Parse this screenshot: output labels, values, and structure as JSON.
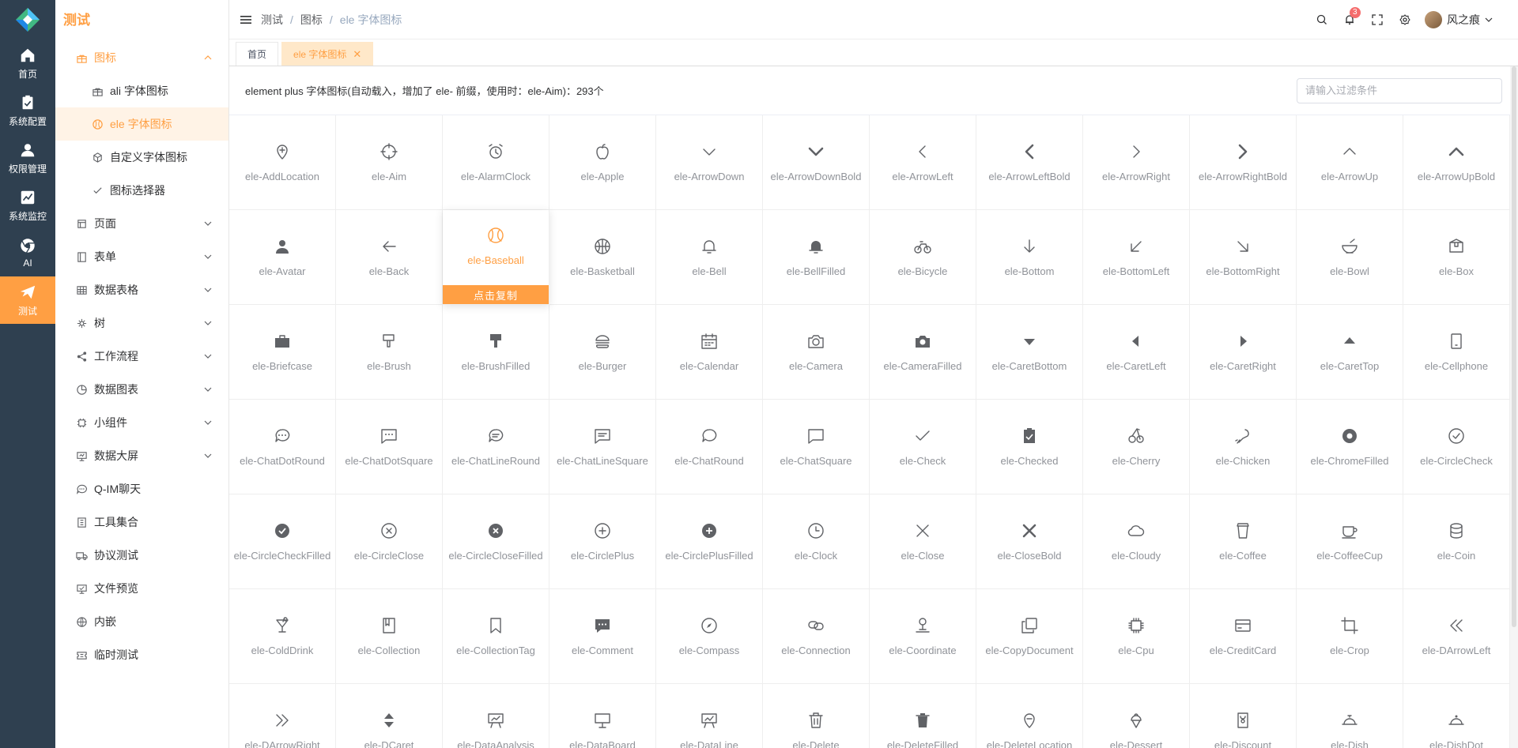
{
  "rail": {
    "items": [
      {
        "label": "首页",
        "icon": "home-icon"
      },
      {
        "label": "系统配置",
        "icon": "clipboard-icon"
      },
      {
        "label": "权限管理",
        "icon": "user-icon"
      },
      {
        "label": "系统监控",
        "icon": "chart-line-icon"
      },
      {
        "label": "AI",
        "icon": "chrome-icon"
      },
      {
        "label": "测试",
        "icon": "paper-plane-icon",
        "active": true
      }
    ]
  },
  "submenu": {
    "title": "测试",
    "items": [
      {
        "label": "图标",
        "icon": "gift-icon",
        "open": true
      },
      {
        "label": "ali 字体图标",
        "icon": "gift-icon",
        "child": true
      },
      {
        "label": "ele 字体图标",
        "icon": "baseball-icon",
        "child": true,
        "active": true
      },
      {
        "label": "自定义字体图标",
        "icon": "cube-icon",
        "child": true
      },
      {
        "label": "图标选择器",
        "icon": "check-icon",
        "child": true
      },
      {
        "label": "页面",
        "icon": "box-icon",
        "collapsed": true
      },
      {
        "label": "表单",
        "icon": "notebook-icon",
        "collapsed": true
      },
      {
        "label": "数据表格",
        "icon": "grid-icon",
        "collapsed": true
      },
      {
        "label": "树",
        "icon": "tree-icon",
        "collapsed": true
      },
      {
        "label": "工作流程",
        "icon": "share-icon",
        "collapsed": true
      },
      {
        "label": "数据图表",
        "icon": "pie-chart-icon",
        "collapsed": true
      },
      {
        "label": "小组件",
        "icon": "chip-icon",
        "collapsed": true
      },
      {
        "label": "数据大屏",
        "icon": "monitor-icon",
        "collapsed": true
      },
      {
        "label": "Q-IM聊天",
        "icon": "chat-icon"
      },
      {
        "label": "工具集合",
        "icon": "tools-icon"
      },
      {
        "label": "协议测试",
        "icon": "truck-icon"
      },
      {
        "label": "文件预览",
        "icon": "preview-icon"
      },
      {
        "label": "内嵌",
        "icon": "globe-icon"
      },
      {
        "label": "临时测试",
        "icon": "ticket-icon"
      }
    ]
  },
  "header": {
    "breadcrumb": [
      "测试",
      "图标",
      "ele 字体图标"
    ],
    "notification_count": "3",
    "user_name": "风之痕"
  },
  "tabs": [
    {
      "label": "首页",
      "active": false
    },
    {
      "label": "ele 字体图标",
      "active": true
    }
  ],
  "toolbar": {
    "description": "element plus 字体图标(自动载入，增加了 ele- 前缀，使用时：ele-Aim)：293个",
    "filter_placeholder": "请输入过滤条件"
  },
  "copy_label": "点击复制",
  "icons": [
    "ele-AddLocation",
    "ele-Aim",
    "ele-AlarmClock",
    "ele-Apple",
    "ele-ArrowDown",
    "ele-ArrowDownBold",
    "ele-ArrowLeft",
    "ele-ArrowLeftBold",
    "ele-ArrowRight",
    "ele-ArrowRightBold",
    "ele-ArrowUp",
    "ele-ArrowUpBold",
    "ele-Avatar",
    "ele-Back",
    "ele-Baseball",
    "ele-Basketball",
    "ele-Bell",
    "ele-BellFilled",
    "ele-Bicycle",
    "ele-Bottom",
    "ele-BottomLeft",
    "ele-BottomRight",
    "ele-Bowl",
    "ele-Box",
    "ele-Briefcase",
    "ele-Brush",
    "ele-BrushFilled",
    "ele-Burger",
    "ele-Calendar",
    "ele-Camera",
    "ele-CameraFilled",
    "ele-CaretBottom",
    "ele-CaretLeft",
    "ele-CaretRight",
    "ele-CaretTop",
    "ele-Cellphone",
    "ele-ChatDotRound",
    "ele-ChatDotSquare",
    "ele-ChatLineRound",
    "ele-ChatLineSquare",
    "ele-ChatRound",
    "ele-ChatSquare",
    "ele-Check",
    "ele-Checked",
    "ele-Cherry",
    "ele-Chicken",
    "ele-ChromeFilled",
    "ele-CircleCheck",
    "ele-CircleCheckFilled",
    "ele-CircleClose",
    "ele-CircleCloseFilled",
    "ele-CirclePlus",
    "ele-CirclePlusFilled",
    "ele-Clock",
    "ele-Close",
    "ele-CloseBold",
    "ele-Cloudy",
    "ele-Coffee",
    "ele-CoffeeCup",
    "ele-Coin",
    "ele-ColdDrink",
    "ele-Collection",
    "ele-CollectionTag",
    "ele-Comment",
    "ele-Compass",
    "ele-Connection",
    "ele-Coordinate",
    "ele-CopyDocument",
    "ele-Cpu",
    "ele-CreditCard",
    "ele-Crop",
    "ele-DArrowLeft",
    "ele-DArrowRight",
    "ele-DCaret",
    "ele-DataAnalysis",
    "ele-DataBoard",
    "ele-DataLine",
    "ele-Delete",
    "ele-DeleteFilled",
    "ele-DeleteLocation",
    "ele-Dessert",
    "ele-Discount",
    "ele-Dish",
    "ele-DishDot"
  ],
  "hovered_icon": "ele-Baseball"
}
